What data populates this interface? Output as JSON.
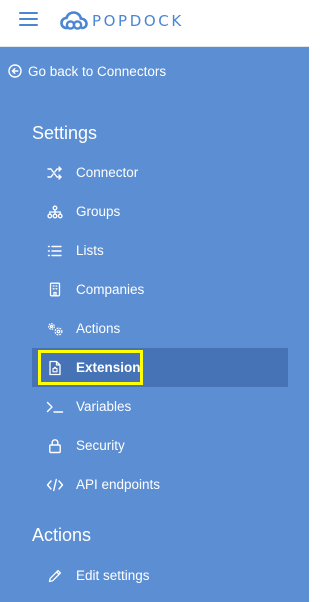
{
  "header": {
    "menu_icon": "hamburger-icon",
    "logo_icon": "cloud-logo-icon",
    "brand": "POPDOCK"
  },
  "back_link": {
    "icon": "arrow-circle-left-icon",
    "label": "Go back to Connectors"
  },
  "settings": {
    "title": "Settings",
    "items": [
      {
        "label": "Connector",
        "icon": "shuffle-icon"
      },
      {
        "label": "Groups",
        "icon": "hierarchy-icon"
      },
      {
        "label": "Lists",
        "icon": "list-icon"
      },
      {
        "label": "Companies",
        "icon": "building-icon"
      },
      {
        "label": "Actions",
        "icon": "gears-icon"
      },
      {
        "label": "Extension",
        "icon": "file-puzzle-icon",
        "active": true
      },
      {
        "label": "Variables",
        "icon": "terminal-icon"
      },
      {
        "label": "Security",
        "icon": "lock-icon"
      },
      {
        "label": "API endpoints",
        "icon": "code-icon"
      }
    ]
  },
  "actions": {
    "title": "Actions",
    "items": [
      {
        "label": "Edit settings",
        "icon": "pencil-icon"
      }
    ]
  },
  "colors": {
    "sidebar_bg": "#5b8ed3",
    "active_bg": "#4673b5",
    "brand": "#4a86d1",
    "highlight": "#ffff00"
  }
}
